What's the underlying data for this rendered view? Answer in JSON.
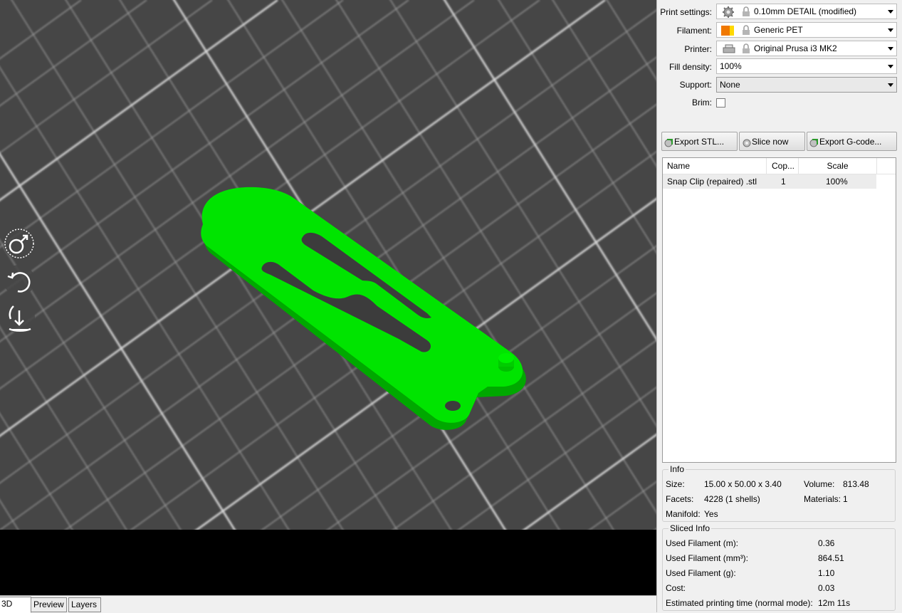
{
  "viewport": {
    "model_color": "#00e000",
    "background": "#464646",
    "nav_icons": [
      "move-camera-icon",
      "rotate-camera-icon",
      "zoom-camera-icon"
    ]
  },
  "tabs": [
    {
      "label": "3D",
      "active": true
    },
    {
      "label": "Preview",
      "active": false
    },
    {
      "label": "Layers",
      "active": false
    }
  ],
  "settings": {
    "print_settings": {
      "label": "Print settings:",
      "value": "0.10mm DETAIL (modified)"
    },
    "filament": {
      "label": "Filament:",
      "value": "Generic PET",
      "colors": [
        "#f07800",
        "#ffd800"
      ]
    },
    "printer": {
      "label": "Printer:",
      "value": "Original Prusa i3 MK2"
    },
    "fill_density": {
      "label": "Fill density:",
      "value": "100%"
    },
    "support": {
      "label": "Support:",
      "value": "None"
    },
    "brim": {
      "label": "Brim:",
      "checked": false
    }
  },
  "buttons": {
    "export_stl": "Export STL...",
    "slice_now": "Slice now",
    "export_gcode": "Export G-code..."
  },
  "object_list": {
    "columns": [
      "Name",
      "Cop...",
      "Scale"
    ],
    "rows": [
      {
        "name": "Snap Clip (repaired) .stl",
        "copies": "1",
        "scale": "100%"
      }
    ]
  },
  "info": {
    "title": "Info",
    "size_label": "Size:",
    "size": "15.00 x 50.00 x 3.40",
    "volume_label": "Volume:",
    "volume": "813.48",
    "facets_label": "Facets:",
    "facets": "4228 (1 shells)",
    "materials_label": "Materials:",
    "materials": "1",
    "manifold_label": "Manifold:",
    "manifold": "Yes"
  },
  "sliced_info": {
    "title": "Sliced Info",
    "rows": [
      {
        "label": "Used Filament (m):",
        "value": "0.36"
      },
      {
        "label": "Used Filament (mm³):",
        "value": "864.51"
      },
      {
        "label": "Used Filament (g):",
        "value": "1.10"
      },
      {
        "label": "Cost:",
        "value": "0.03"
      },
      {
        "label": "Estimated printing time (normal mode):",
        "value": "12m 11s"
      }
    ]
  }
}
